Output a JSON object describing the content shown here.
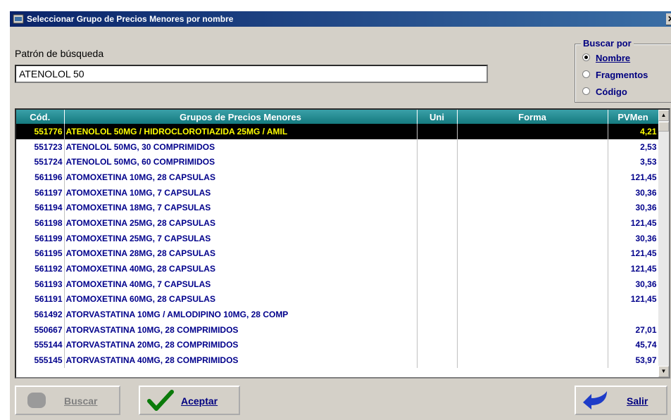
{
  "window": {
    "title": "Seleccionar Grupo de Precios Menores por nombre",
    "close": "✕"
  },
  "search": {
    "label": "Patrón de búsqueda",
    "value": "ATENOLOL 50"
  },
  "search_by": {
    "legend": "Buscar por",
    "options": [
      {
        "label": "Nombre",
        "selected": true
      },
      {
        "label": "Fragmentos",
        "selected": false
      },
      {
        "label": "Código",
        "selected": false
      }
    ]
  },
  "table": {
    "columns": [
      "Cód.",
      "Grupos de Precios Menores",
      "Uni",
      "Forma",
      "PVMen"
    ],
    "rows": [
      {
        "code": "551776",
        "name": "ATENOLOL 50MG / HIDROCLOROTIAZIDA 25MG / AMIL",
        "uni": "",
        "forma": "",
        "price": "4,21",
        "selected": true
      },
      {
        "code": "551723",
        "name": "ATENOLOL 50MG, 30 COMPRIMIDOS",
        "uni": "",
        "forma": "",
        "price": "2,53"
      },
      {
        "code": "551724",
        "name": "ATENOLOL 50MG, 60 COMPRIMIDOS",
        "uni": "",
        "forma": "",
        "price": "3,53"
      },
      {
        "code": "561196",
        "name": "ATOMOXETINA 10MG, 28 CAPSULAS",
        "uni": "",
        "forma": "",
        "price": "121,45"
      },
      {
        "code": "561197",
        "name": "ATOMOXETINA 10MG, 7 CAPSULAS",
        "uni": "",
        "forma": "",
        "price": "30,36"
      },
      {
        "code": "561194",
        "name": "ATOMOXETINA 18MG, 7 CAPSULAS",
        "uni": "",
        "forma": "",
        "price": "30,36"
      },
      {
        "code": "561198",
        "name": "ATOMOXETINA 25MG, 28 CAPSULAS",
        "uni": "",
        "forma": "",
        "price": "121,45"
      },
      {
        "code": "561199",
        "name": "ATOMOXETINA 25MG, 7 CAPSULAS",
        "uni": "",
        "forma": "",
        "price": "30,36"
      },
      {
        "code": "561195",
        "name": "ATOMOXETINA 28MG, 28 CAPSULAS",
        "uni": "",
        "forma": "",
        "price": "121,45"
      },
      {
        "code": "561192",
        "name": "ATOMOXETINA 40MG, 28 CAPSULAS",
        "uni": "",
        "forma": "",
        "price": "121,45"
      },
      {
        "code": "561193",
        "name": "ATOMOXETINA 40MG, 7 CAPSULAS",
        "uni": "",
        "forma": "",
        "price": "30,36"
      },
      {
        "code": "561191",
        "name": "ATOMOXETINA 60MG, 28 CAPSULAS",
        "uni": "",
        "forma": "",
        "price": "121,45"
      },
      {
        "code": "561492",
        "name": "ATORVASTATINA 10MG / AMLODIPINO 10MG, 28 COMP",
        "uni": "",
        "forma": "",
        "price": ""
      },
      {
        "code": "550667",
        "name": "ATORVASTATINA 10MG, 28 COMPRIMIDOS",
        "uni": "",
        "forma": "",
        "price": "27,01"
      },
      {
        "code": "555144",
        "name": "ATORVASTATINA 20MG, 28 COMPRIMIDOS",
        "uni": "",
        "forma": "",
        "price": "45,74"
      },
      {
        "code": "555145",
        "name": "ATORVASTATINA 40MG, 28 COMPRIMIDOS",
        "uni": "",
        "forma": "",
        "price": "53,97"
      }
    ]
  },
  "buttons": {
    "buscar": "Buscar",
    "aceptar": "Aceptar",
    "salir": "Salir"
  },
  "icons": {
    "window": "window-app-icon",
    "buscar": "grey-disabled-icon",
    "aceptar": "green-checkmark-icon",
    "salir": "blue-back-arrow-icon",
    "close": "close-icon"
  },
  "colors": {
    "title_bar": "#0a246a",
    "header": "#1f8a90",
    "row_text": "#00008b",
    "selected_bg": "#000000",
    "selected_text": "#ffff00"
  }
}
